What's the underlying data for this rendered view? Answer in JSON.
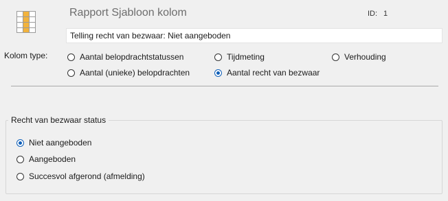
{
  "header": {
    "title": "Rapport Sjabloon kolom",
    "id_label": "ID:",
    "id_value": "1",
    "name_value": "Telling recht van bezwaar: Niet aangeboden",
    "icon": "table-column-icon"
  },
  "kolom_type": {
    "label": "Kolom type:",
    "options": [
      {
        "label": "Aantal belopdrachtstatussen",
        "checked": false
      },
      {
        "label": "Tijdmeting",
        "checked": false
      },
      {
        "label": "Verhouding",
        "checked": false
      },
      {
        "label": "Aantal (unieke) belopdrachten",
        "checked": false
      },
      {
        "label": "Aantal recht van bezwaar",
        "checked": true
      }
    ]
  },
  "status_group": {
    "title": "Recht van bezwaar status",
    "options": [
      {
        "label": "Niet aangeboden",
        "checked": true
      },
      {
        "label": "Aangeboden",
        "checked": false
      },
      {
        "label": "Succesvol afgerond (afmelding)",
        "checked": false
      }
    ]
  },
  "colors": {
    "accent": "#0f5fb8",
    "icon_highlight": "#f2b33d",
    "background": "#f0f0f0"
  }
}
